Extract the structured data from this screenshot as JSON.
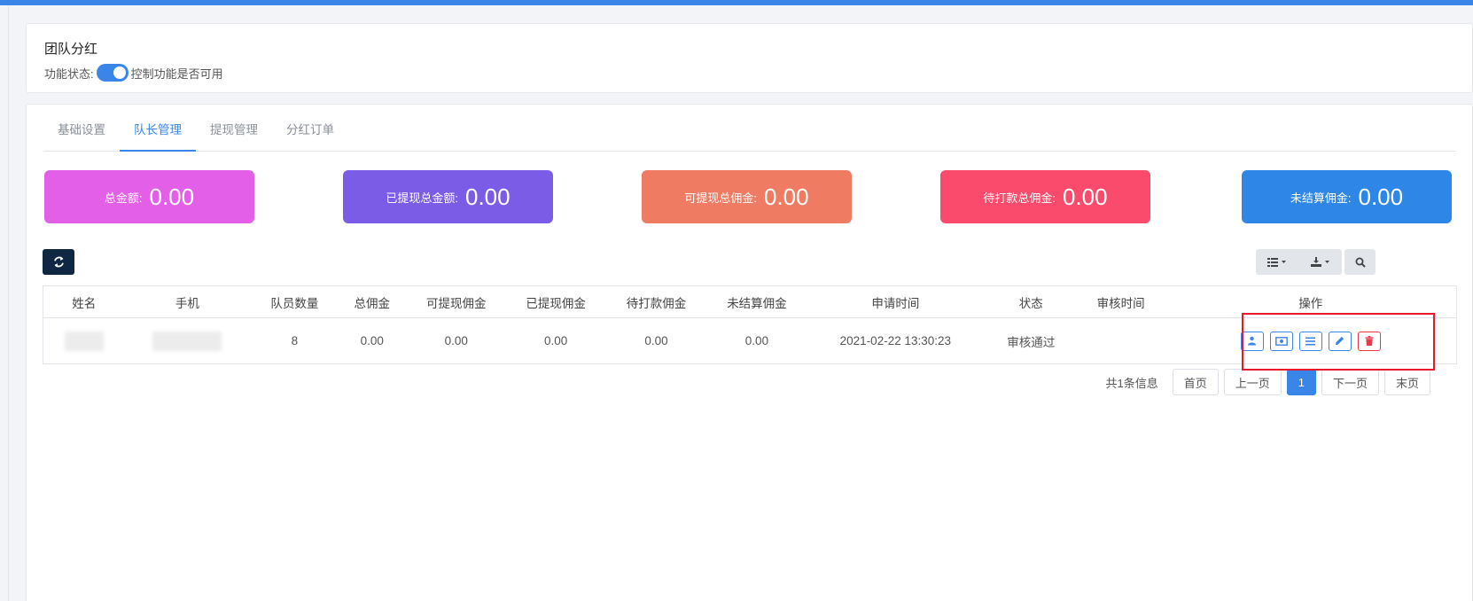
{
  "page": {
    "title": "团队分红",
    "status_label": "功能状态:",
    "status_hint": "控制功能是否可用"
  },
  "tabs": [
    {
      "label": "基础设置"
    },
    {
      "label": "队长管理"
    },
    {
      "label": "提现管理"
    },
    {
      "label": "分红订单"
    }
  ],
  "stats": [
    {
      "label": "总金额:",
      "value": "0.00",
      "color": "#e45fe8"
    },
    {
      "label": "已提现总金额:",
      "value": "0.00",
      "color": "#7b5ce6"
    },
    {
      "label": "可提现总佣金:",
      "value": "0.00",
      "color": "#ee7b62"
    },
    {
      "label": "待打款总佣金:",
      "value": "0.00",
      "color": "#fb4b6c"
    },
    {
      "label": "未结算佣金:",
      "value": "0.00",
      "color": "#2e87e6"
    }
  ],
  "toolbar": {
    "refresh_icon": "refresh-icon",
    "columns_icon": "list-icon",
    "export_icon": "download-icon",
    "search_icon": "search-icon"
  },
  "table": {
    "headers": [
      "姓名",
      "手机",
      "队员数量",
      "总佣金",
      "可提现佣金",
      "已提现佣金",
      "待打款佣金",
      "未结算佣金",
      "申请时间",
      "状态",
      "审核时间",
      "操作"
    ],
    "rows": [
      {
        "members": "8",
        "total": "0.00",
        "withdrawable": "0.00",
        "withdrawn": "0.00",
        "pending": "0.00",
        "unsettled": "0.00",
        "apply_time": "2021-02-22 13:30:23",
        "status": "审核通过",
        "review_time": ""
      }
    ],
    "actions": [
      "user-icon",
      "money-icon",
      "list-icon",
      "edit-icon",
      "trash-icon"
    ]
  },
  "pagination": {
    "info": "共1条信息",
    "first": "首页",
    "prev": "上一页",
    "current": "1",
    "next": "下一页",
    "last": "末页"
  },
  "colors": {
    "accent": "#3a86e8",
    "danger": "#e8394a",
    "highlight": "#e8182a"
  }
}
